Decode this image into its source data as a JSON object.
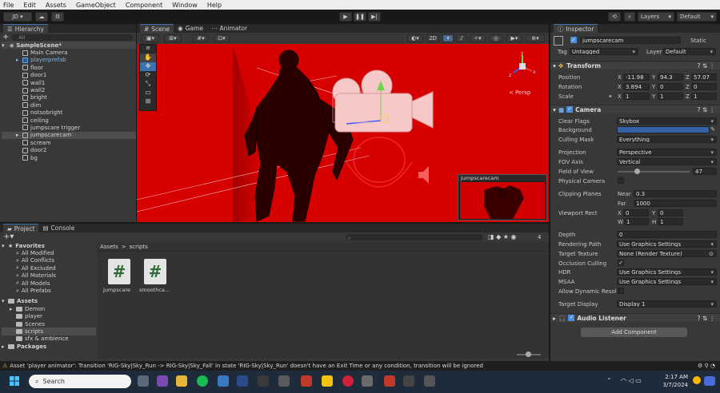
{
  "menu": [
    "File",
    "Edit",
    "Assets",
    "GameObject",
    "Component",
    "Window",
    "Help"
  ],
  "toolbar": {
    "account": "JD",
    "layers": "Layers",
    "layout": "Default"
  },
  "hierarchy": {
    "title": "Hierarchy",
    "search_placeholder": "All",
    "scene": "SampleScene*",
    "items": [
      "Main Camera",
      "playerprefab",
      "floor",
      "door1",
      "wall1",
      "wall2",
      "bright",
      "dim",
      "notsobright",
      "ceiling",
      "jumpscare trigger",
      "jumpscarecam",
      "scream",
      "door2",
      "bg"
    ]
  },
  "scene_tabs": [
    "Scene",
    "Game",
    "Animator"
  ],
  "scene_view": {
    "mode_2d": "2D",
    "persp": "< Persp",
    "camera_preview_title": "jumpscarecam",
    "axis_y": "y",
    "axis_x": "x",
    "axis_z": "z",
    "colors": {
      "background": "#d40000",
      "dark": "#8a0000"
    }
  },
  "project": {
    "tabs": [
      "Project",
      "Console"
    ],
    "favorites_label": "Favorites",
    "favorites": [
      "All Modified",
      "All Conflicts",
      "All Excluded",
      "All Materials",
      "All Models",
      "All Prefabs"
    ],
    "assets_label": "Assets",
    "assets": [
      "Demon",
      "player",
      "Scenes",
      "scripts",
      "sfx & ambience"
    ],
    "packages_label": "Packages",
    "breadcrumb": [
      "Assets",
      "scripts"
    ],
    "files": [
      "jumpscare",
      "smoothca..."
    ],
    "badge": "4"
  },
  "inspector": {
    "title": "Inspector",
    "object_name": "jumpscarecam",
    "static_label": "Static",
    "tag_label": "Tag",
    "tag": "Untagged",
    "layer_label": "Layer",
    "layer": "Default",
    "transform": {
      "title": "Transform",
      "position_label": "Position",
      "position": [
        "-11.98",
        "94.3",
        "57.07"
      ],
      "rotation_label": "Rotation",
      "rotation": [
        "3.894",
        "0",
        "0"
      ],
      "scale_label": "Scale",
      "scale": [
        "1",
        "1",
        "1"
      ]
    },
    "camera": {
      "title": "Camera",
      "clear_flags_label": "Clear Flags",
      "clear_flags": "Skybox",
      "background_label": "Background",
      "background_color": "#3660a8",
      "culling_mask_label": "Culling Mask",
      "culling_mask": "Everything",
      "projection_label": "Projection",
      "projection": "Perspective",
      "fov_axis_label": "FOV Axis",
      "fov_axis": "Vertical",
      "fov_label": "Field of View",
      "fov": "47",
      "physical_label": "Physical Camera",
      "clipping_label": "Clipping Planes",
      "near_label": "Near",
      "near": "0.3",
      "far_label": "Far",
      "far": "1000",
      "viewport_label": "Viewport Rect",
      "vx": "0",
      "vy": "0",
      "vw": "1",
      "vh": "1",
      "depth_label": "Depth",
      "depth": "0",
      "rendering_path_label": "Rendering Path",
      "rendering_path": "Use Graphics Settings",
      "target_texture_label": "Target Texture",
      "target_texture": "None (Render Texture)",
      "occlusion_label": "Occlusion Culling",
      "hdr_label": "HDR",
      "hdr": "Use Graphics Settings",
      "msaa_label": "MSAA",
      "msaa": "Use Graphics Settings",
      "dynres_label": "Allow Dynamic Resol",
      "target_display_label": "Target Display",
      "target_display": "Display 1"
    },
    "audio_listener": "Audio Listener",
    "add_component": "Add Component"
  },
  "status_bar": "Asset 'player animator': Transition 'RIG-Sky|Sky_Run -> RIG-Sky|Sky_Fall' in state 'RIG-Sky|Sky_Run' doesn't have an Exit Time or any condition, transition will be ignored",
  "taskbar": {
    "search": "Search",
    "time": "2:17 AM",
    "date": "3/7/2024"
  }
}
